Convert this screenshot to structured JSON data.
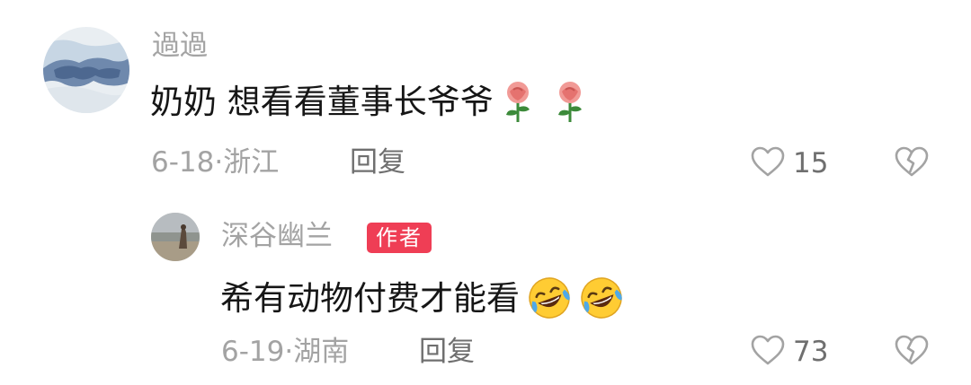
{
  "comments": [
    {
      "username": "過過",
      "content": "奶奶 想看看董事长爷爷",
      "emojis": [
        "rose-icon",
        "rose-icon"
      ],
      "date": "6-18",
      "separator": "·",
      "location": "浙江",
      "reply_label": "回复",
      "like_count": "15"
    }
  ],
  "replies": [
    {
      "username": "深谷幽兰",
      "badge": "作者",
      "content": "希有动物付费才能看",
      "emojis": [
        "rofl-icon",
        "rofl-icon"
      ],
      "date": "6-19",
      "separator": "·",
      "location": "湖南",
      "reply_label": "回复",
      "like_count": "73"
    }
  ],
  "colors": {
    "author_badge": "#ef3e55",
    "secondary_text": "#a3a3a3",
    "primary_text": "#161616"
  }
}
